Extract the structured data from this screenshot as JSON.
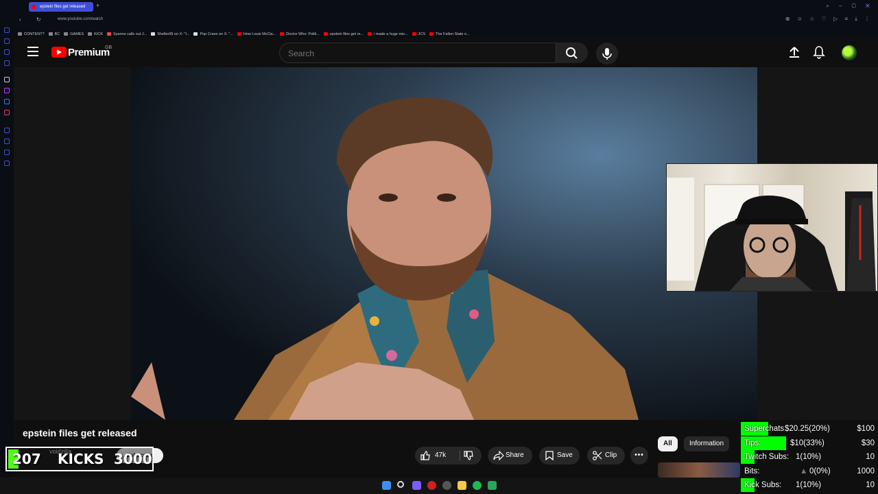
{
  "browser": {
    "active_tab_title": "epstein files get released",
    "address": "www.youtube.com/watch",
    "bookmarks": [
      {
        "label": "CONTENT?",
        "color": "#888888"
      },
      {
        "label": "BC",
        "color": "#888888"
      },
      {
        "label": "GAMES",
        "color": "#888888"
      },
      {
        "label": "KICK",
        "color": "#888888"
      },
      {
        "label": "Syanne calls out J...",
        "color": "#ff4444"
      },
      {
        "label": "Shelbo99 on X: \"I...",
        "color": "#dddddd"
      },
      {
        "label": "Pop Crave on X: \"...",
        "color": "#dddddd"
      },
      {
        "label": "How Louis McCla...",
        "color": "#ff0000"
      },
      {
        "label": "Doctor Who: Politi...",
        "color": "#ff0000"
      },
      {
        "label": "epstein files get re...",
        "color": "#ff0000"
      },
      {
        "label": "i made a huge mis...",
        "color": "#ff0000"
      },
      {
        "label": "JCS",
        "color": "#ff0000"
      },
      {
        "label": "The Fallen State o...",
        "color": "#ff0000"
      }
    ]
  },
  "masthead": {
    "logo_text": "Premium",
    "region": "GB",
    "search_placeholder": "Search"
  },
  "video": {
    "title": "epstein files get released",
    "channel": "voidzilla",
    "subscribe_label": "Subscribe",
    "likes": "47k",
    "share_label": "Share",
    "save_label": "Save",
    "clip_label": "Clip",
    "more_label": "•••"
  },
  "kicks_widget": {
    "current": "207",
    "label": "KICKS",
    "goal": "3000",
    "progress_fraction": 0.069
  },
  "chips": {
    "all": "All",
    "information": "Information"
  },
  "stats": [
    {
      "label": "Superchats",
      "value": "$20.25(20%)",
      "goal": "$100",
      "fraction": 0.2
    },
    {
      "label": "Tips:",
      "value": "$10(33%)",
      "goal": "$30",
      "fraction": 0.33
    },
    {
      "label": "Twitch Subs:",
      "value": "1(10%)",
      "goal": "10",
      "fraction": 0.1
    },
    {
      "label": "Bits:",
      "value": "0(0%)",
      "goal": "1000",
      "fraction": 0.0
    },
    {
      "label": "Kick Subs:",
      "value": "1(10%)",
      "goal": "10",
      "fraction": 0.1
    }
  ],
  "colors": {
    "accent_green": "#00ff00",
    "kick_green": "#53fc18",
    "youtube_red": "#ff0000",
    "browser_accent": "#3e4fd6"
  }
}
